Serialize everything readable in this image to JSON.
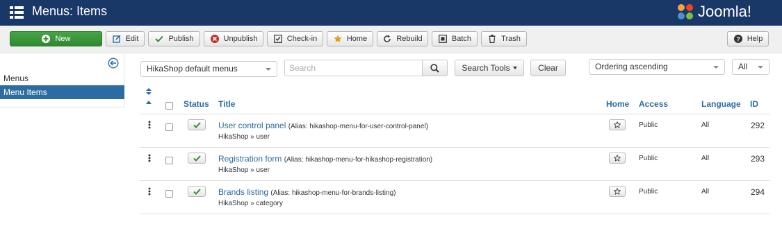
{
  "header": {
    "title": "Menus: Items",
    "brand": "Joomla!",
    "colors": {
      "bar": "#1a3867"
    }
  },
  "toolbar": {
    "new": "New",
    "edit": "Edit",
    "publish": "Publish",
    "unpublish": "Unpublish",
    "checkin": "Check-in",
    "home": "Home",
    "rebuild": "Rebuild",
    "batch": "Batch",
    "trash": "Trash",
    "help": "Help"
  },
  "sidebar": {
    "items": [
      {
        "label": "Menus"
      },
      {
        "label": "Menu Items",
        "active": true
      }
    ]
  },
  "filters": {
    "menu_select": "HikaShop default menus",
    "search_placeholder": "Search",
    "search_tools": "Search Tools",
    "clear": "Clear",
    "ordering": "Ordering ascending",
    "limit": "All"
  },
  "table": {
    "headers": {
      "status": "Status",
      "title": "Title",
      "home": "Home",
      "access": "Access",
      "language": "Language",
      "id": "ID"
    },
    "rows": [
      {
        "title": "User control panel",
        "alias": "(Alias: hikashop-menu-for-user-control-panel)",
        "sub": "HikaShop » user",
        "access": "Public",
        "language": "All",
        "id": "292"
      },
      {
        "title": "Registration form",
        "alias": "(Alias: hikashop-menu-for-hikashop-registration)",
        "sub": "HikaShop » user",
        "access": "Public",
        "language": "All",
        "id": "293"
      },
      {
        "title": "Brands listing",
        "alias": "(Alias: hikashop-menu-for-brands-listing)",
        "sub": "HikaShop » category",
        "access": "Public",
        "language": "All",
        "id": "294"
      }
    ]
  }
}
